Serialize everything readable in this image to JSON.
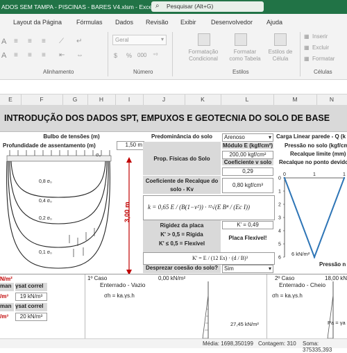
{
  "window": {
    "title": "ADOS SEM TAMPA - PISCINAS - BARES V4.xlsm  -  Excel",
    "search_placeholder": "Pesquisar (Alt+G)"
  },
  "tabs": [
    "Layout da Página",
    "Fórmulas",
    "Dados",
    "Revisão",
    "Exibir",
    "Desenvolvedor",
    "Ajuda"
  ],
  "ribbon": {
    "font_name": "Arial",
    "number_format": "Geral",
    "groups": {
      "alignment": "Alinhamento",
      "number": "Número",
      "styles": "Estilos",
      "cells": "Células"
    },
    "styles_buttons": [
      "Formatação Condicional",
      "Formatar como Tabela",
      "Estilos de Célula"
    ],
    "cells_buttons": [
      "Inserir",
      "Excluir",
      "Formatar"
    ],
    "number_symbols": [
      "$",
      "%",
      "000"
    ]
  },
  "columns": [
    "E",
    "F",
    "G",
    "H",
    "I",
    "J",
    "K",
    "L",
    "M",
    "N"
  ],
  "sheet": {
    "banner": "INTRODUÇÃO DOS DADOS SPT, EMPUXOS E GEOTECNIA DO SOLO DE BASE",
    "bulbo_title": "Bulbo de tensões (m)",
    "prof_label": "Profundidade de assentamento (m)",
    "prof_value": "1,50 m",
    "sigma0": "σ₀",
    "bulb_labels": [
      "0,8 σ₀",
      "0,4 σ₀",
      "0,2 σ₀",
      "0,1 σ₀"
    ],
    "depth_label": "3,00 m",
    "pred_label": "Predominância do solo",
    "pred_value": "Arenoso",
    "prop_label": "Prop. Físicas do Solo",
    "modulo_label": "Módulo E (kgf/cm²)",
    "modulo_value": "200,00 kgf/cm²",
    "poisson_label": "Coeficiente v solo",
    "poisson_value": "0,29",
    "kv_label": "Coeficiente de Recalque do solo - Kv",
    "kv_value": "0,80 kgf/cm³",
    "formula_text": "k = 0,65 E / (B(1−ν²)) · ¹²√(E B⁴ / (Ec I))",
    "rigidez_label": "Rigidez da placa",
    "rigida_label": "K' > 0,5 = Rígida",
    "flexivel_label": "K' ≤ 0,5 = Flexível",
    "kprime_value": "K' = 0,49",
    "placa_result": "Placa Flexível!",
    "formula2_text": "K' = E / (12 Es) · (d / B)³",
    "coesao_label": "Desprezar coesão do solo?",
    "coesao_value": "Sim",
    "carga_label": "Carga Linear parede - Q (k",
    "pressao_label": "Pressão no solo (kgf/cm",
    "recalque_lim_label": "Recalque limite (mm)",
    "recalque_ponto_label": "Recalque no ponto devido",
    "chart_pressure_label": "6 kN/m²",
    "chart_pressao_footer": "Pressão n",
    "left_rows": [
      {
        "a": "N/m²",
        "b": "",
        "c": ""
      },
      {
        "a": "man",
        "b": "γsat correl",
        "c": ""
      },
      {
        "a": "/m³",
        "b": "19 kN/m³",
        "c": ""
      },
      {
        "a": "man",
        "b": "γsat correl",
        "c": ""
      },
      {
        "a": "/m³",
        "b": "20 kN/m³",
        "c": ""
      }
    ],
    "case1_title": "1º Caso",
    "case1_value": "0,00 kN/m²",
    "case1_sub": "Enterrado - Vazio",
    "case1_eq": "σh = ka.γs.h",
    "case1_bottom": "27,45 kN/m²",
    "case2_title": "2º Caso",
    "case2_value": "18,00 kN",
    "case2_sub": "Enterrado - Cheio",
    "case2_eq": "σh = ka.γs.h",
    "case2_pa": "Pa = γa"
  },
  "chart_data": {
    "type": "line",
    "x": [
      0,
      1,
      2
    ],
    "y": [
      0,
      6,
      0
    ],
    "x_ticks": [
      "0",
      "1",
      "1"
    ],
    "y_ticks": [
      "0",
      "1",
      "2",
      "3",
      "4",
      "5",
      "6"
    ],
    "title": "",
    "xlabel": "",
    "ylabel": ""
  },
  "status": {
    "media": "Média: 1698,350199",
    "contagem": "Contagem: 310",
    "soma": "Soma: 375335,393"
  }
}
